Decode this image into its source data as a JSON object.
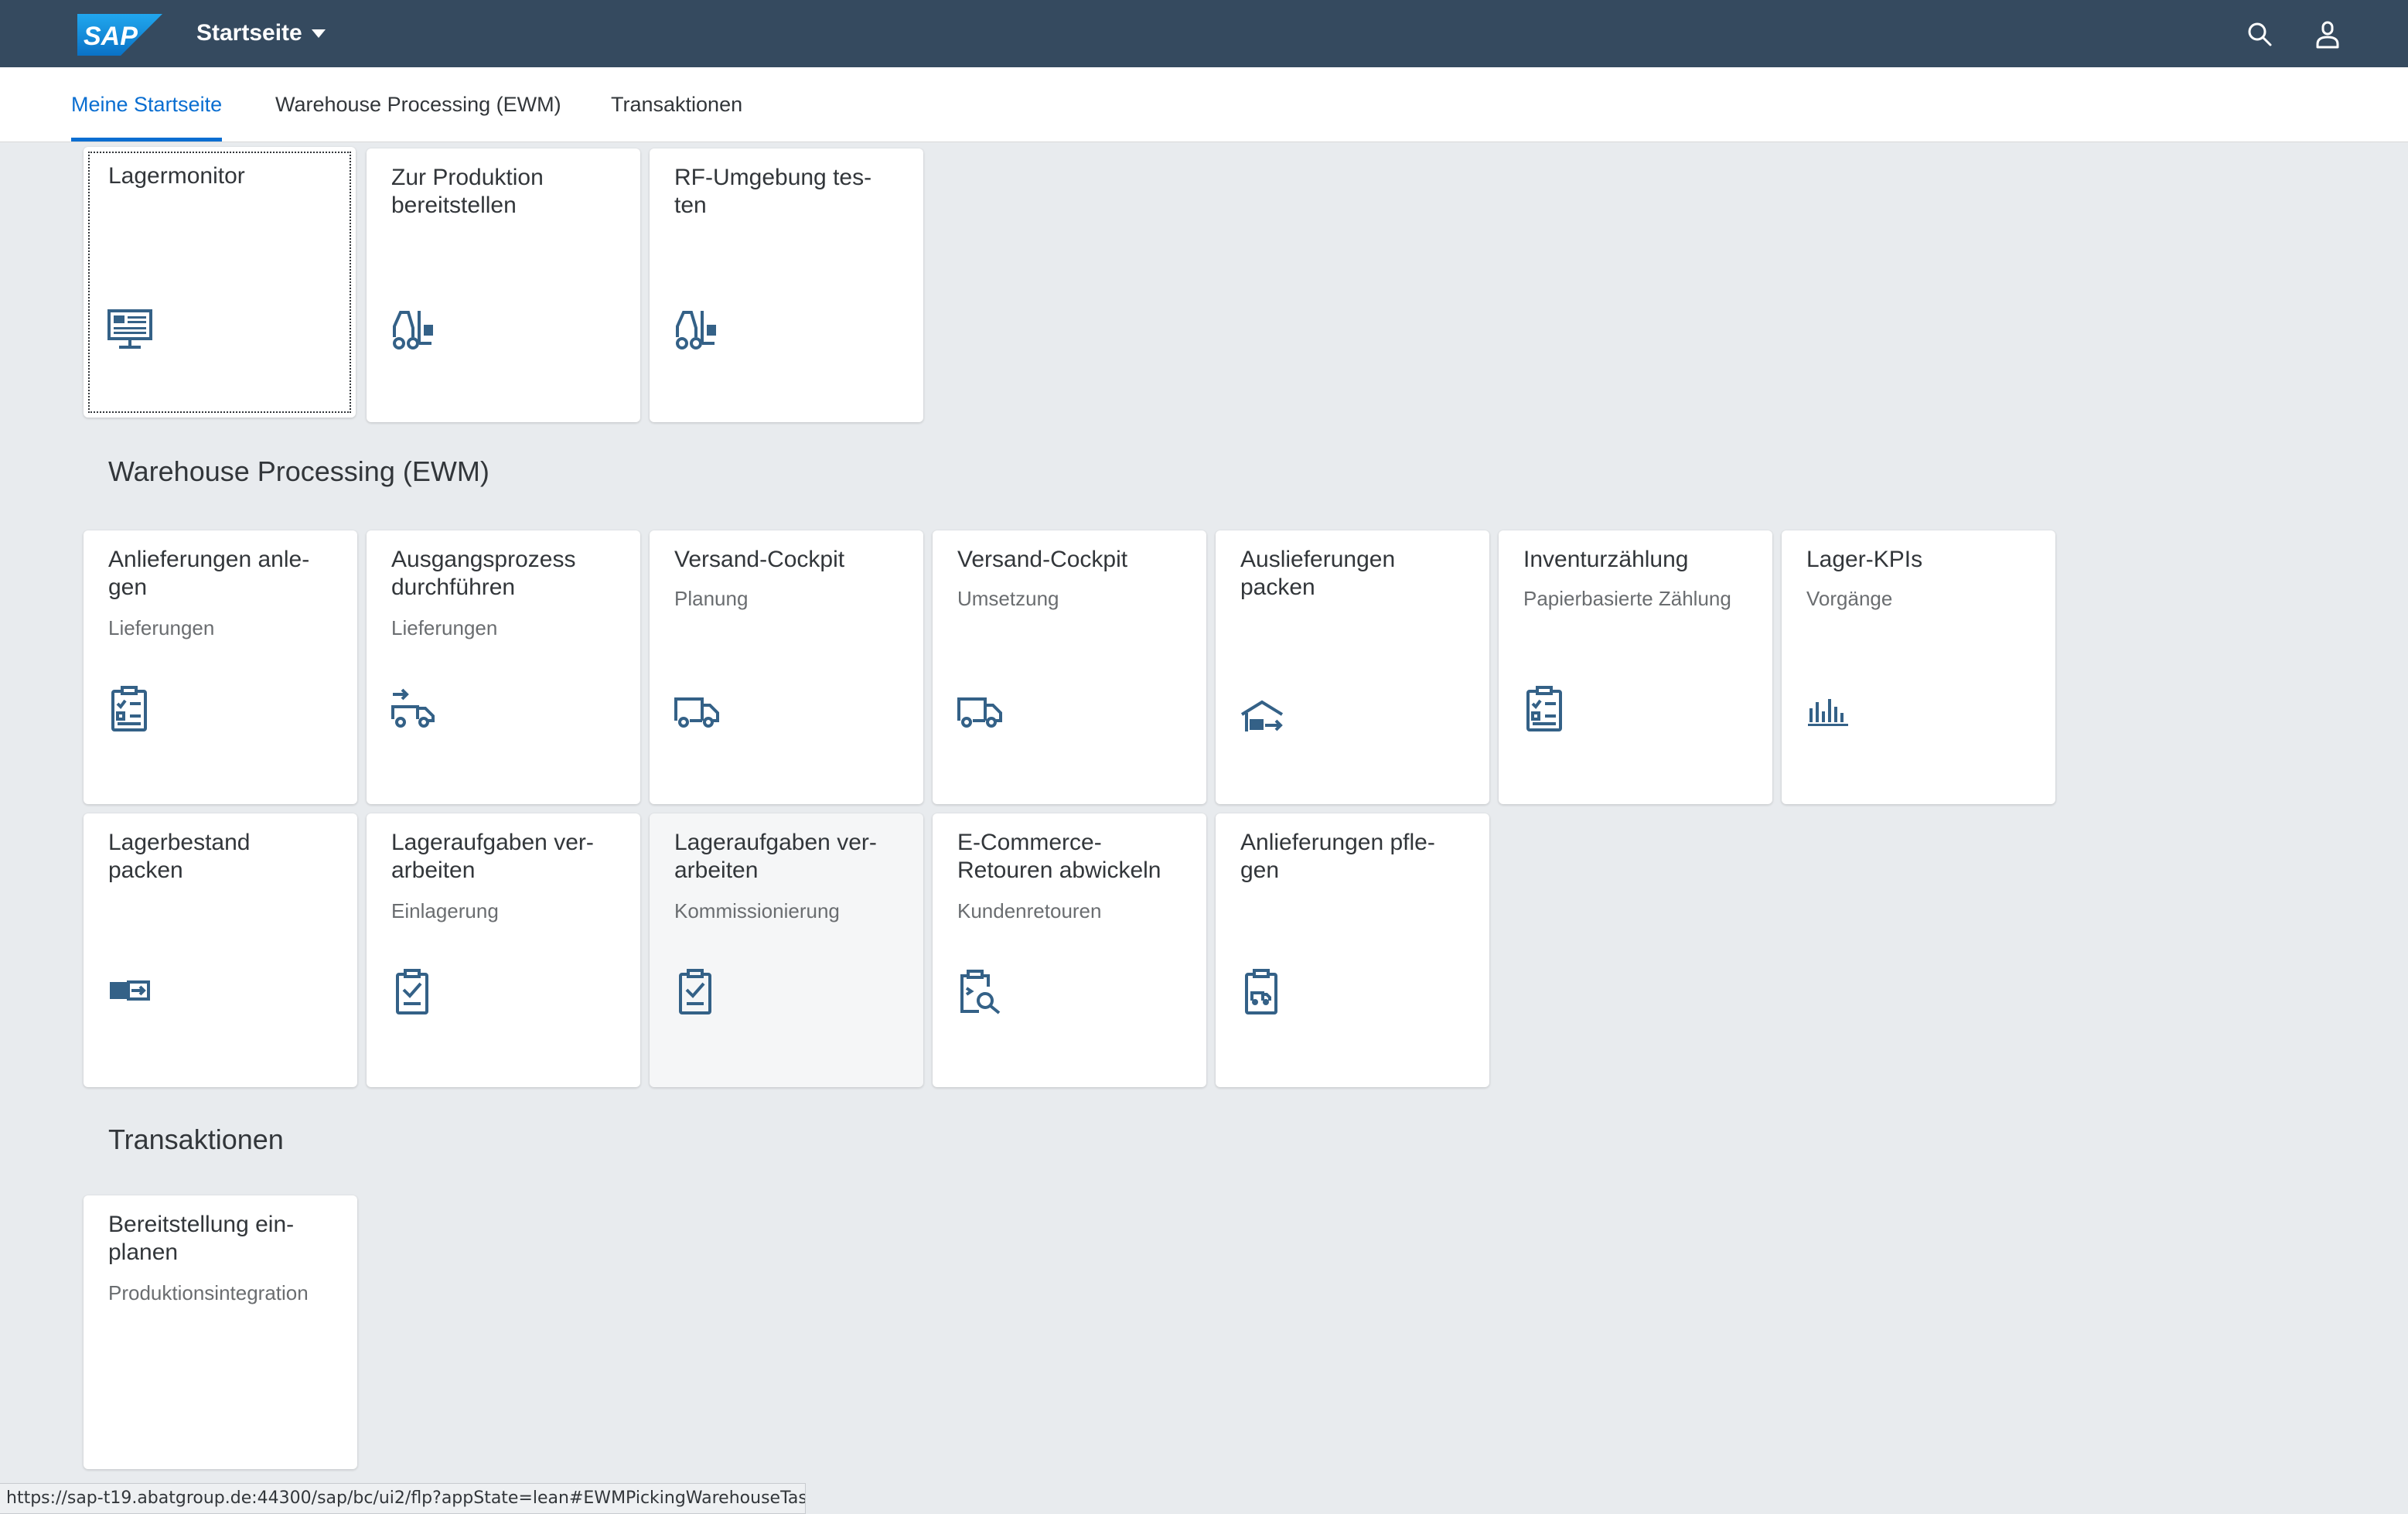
{
  "shell": {
    "logo_text": "SAP",
    "title": "Startseite",
    "colors": {
      "shellbar": "#354a5f",
      "accent": "#0a6ed1",
      "logo_blue": "#1a8de2"
    }
  },
  "anchor_tabs": [
    {
      "label": "Meine Startseite",
      "selected": true
    },
    {
      "label": "Warehouse Processing (EWM)",
      "selected": false
    },
    {
      "label": "Transaktionen",
      "selected": false
    }
  ],
  "sections": {
    "my_home": {
      "tiles": [
        {
          "title": "Lagermonitor",
          "subtitle": "",
          "icon": "monitor-icon"
        },
        {
          "title": "Zur Produktion\nbereitstellen",
          "subtitle": "",
          "icon": "forklift-icon"
        },
        {
          "title": "RF-Umgebung tes-\nten",
          "subtitle": "",
          "icon": "forklift-icon"
        }
      ]
    },
    "ewm": {
      "title": "Warehouse Processing (EWM)",
      "tiles": [
        {
          "title": "Anlieferungen anle-\ngen",
          "subtitle": "Lieferungen",
          "icon": "clipboard-checklist-icon"
        },
        {
          "title": "Ausgangsprozess\ndurchführen",
          "subtitle": "Lieferungen",
          "icon": "outbound-truck-icon"
        },
        {
          "title": "Versand-Cockpit",
          "subtitle": "Planung",
          "icon": "truck-icon"
        },
        {
          "title": "Versand-Cockpit",
          "subtitle": "Umsetzung",
          "icon": "truck-icon"
        },
        {
          "title": "Auslieferungen\npacken",
          "subtitle": "",
          "icon": "warehouse-outbound-icon"
        },
        {
          "title": "Inventurzählung",
          "subtitle": "Papierbasierte Zählung",
          "icon": "clipboard-checklist-icon"
        },
        {
          "title": "Lager-KPIs",
          "subtitle": "Vorgänge",
          "icon": "bar-chart-icon"
        },
        {
          "title": "Lagerbestand\npacken",
          "subtitle": "",
          "icon": "stock-transfer-icon"
        },
        {
          "title": "Lageraufgaben ver-\narbeiten",
          "subtitle": "Einlagerung",
          "icon": "clipboard-task-icon"
        },
        {
          "title": "Lageraufgaben ver-\narbeiten",
          "subtitle": "Kommissionierung",
          "icon": "clipboard-task-icon"
        },
        {
          "title": "E-Commerce-\nRetouren abwickeln",
          "subtitle": "Kundenretouren",
          "icon": "returns-search-icon"
        },
        {
          "title": "Anlieferungen pfle-\ngen",
          "subtitle": "",
          "icon": "clipboard-truck-icon"
        }
      ]
    },
    "transactions": {
      "title": "Transaktionen",
      "tiles": [
        {
          "title": "Bereitstellung ein-\nplanen",
          "subtitle": "Produktionsintegration",
          "icon": ""
        }
      ]
    }
  },
  "status_url": "https://sap-t19.abatgroup.de:44300/sap/bc/ui2/flp?appState=lean#EWMPickingWarehouseTas..."
}
